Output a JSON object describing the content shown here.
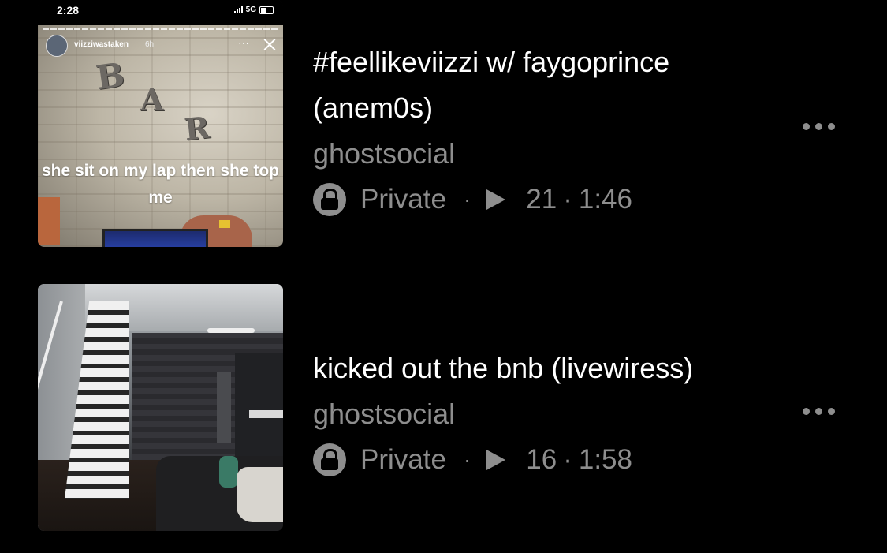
{
  "items": [
    {
      "title": "#feellikeviizzi w/ faygoprince (anem0s)",
      "author": "ghostsocial",
      "visibility": "Private",
      "separator": "·",
      "plays": "21",
      "duration": "1:46",
      "thumbnail": {
        "status_time": "2:28",
        "network": "5G",
        "story_user": "viizziwastaken",
        "story_age": "6h",
        "story_more": "···",
        "sign_letters": [
          "B",
          "A",
          "R"
        ],
        "caption": "she sit on my lap then she top me"
      }
    },
    {
      "title": "kicked out the bnb (livewiress)",
      "author": "ghostsocial",
      "visibility": "Private",
      "separator": "·",
      "plays": "16",
      "duration": "1:58"
    }
  ],
  "colors": {
    "background": "#000000",
    "title": "#ffffff",
    "secondary": "#8e8e8e"
  },
  "icons": {
    "lock": "lock-icon",
    "play": "play-icon",
    "more": "more-options-icon"
  }
}
